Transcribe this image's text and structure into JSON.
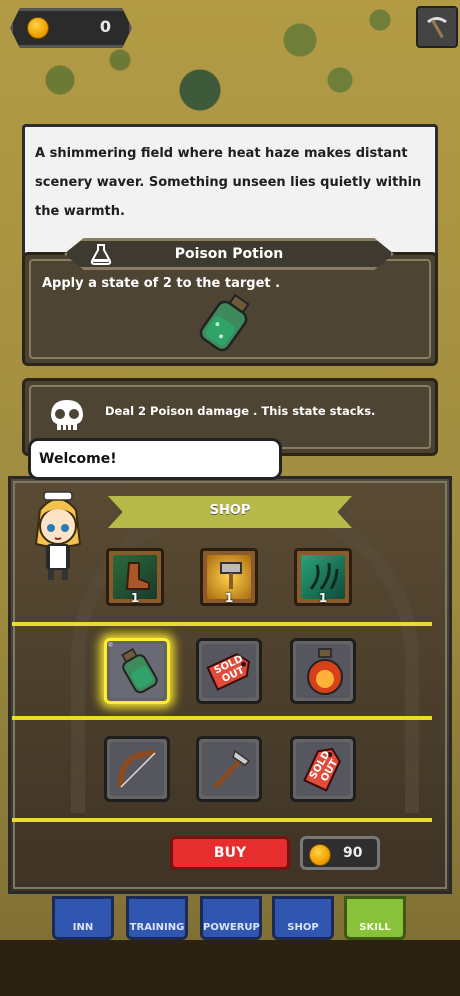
{
  "hud": {
    "coins": "0"
  },
  "description": {
    "text": "A shimmering field where heat haze makes distant scenery waver. Something unseen lies quietly within the warmth."
  },
  "potion": {
    "title": "Poison Potion",
    "description": "Apply a  state of 2 to the target ."
  },
  "state": {
    "description": "Deal 2 Poison damage . This state stacks."
  },
  "dialog": {
    "text": "Welcome!"
  },
  "shop": {
    "title": "SHOP",
    "row1": [
      {
        "icon": "boot-icon",
        "count": "1"
      },
      {
        "icon": "hammer-strike-icon",
        "count": "1"
      },
      {
        "icon": "vine-icon",
        "count": "1"
      }
    ],
    "row2": [
      {
        "icon": "green-potion-icon",
        "status": ""
      },
      {
        "icon": "sold-out-tag-icon",
        "status": "SOLD OUT"
      },
      {
        "icon": "red-potion-icon",
        "status": ""
      }
    ],
    "row3": [
      {
        "icon": "bow-icon",
        "status": ""
      },
      {
        "icon": "pickaxe-icon",
        "status": ""
      },
      {
        "icon": "sold-out-tag-icon",
        "status": "SOLD OUT"
      }
    ],
    "buy_label": "BUY",
    "price": "90"
  },
  "nav": {
    "items": [
      "INN",
      "TRAINING",
      "POWERUP",
      "SHOP",
      "SKILL"
    ],
    "active": "SKILL"
  },
  "colors": {
    "buy": "#e62e2e",
    "highlight": "#f7e52a",
    "banner": "#b7b94a",
    "nav": "#3156b0",
    "nav_active": "#88c13a"
  }
}
